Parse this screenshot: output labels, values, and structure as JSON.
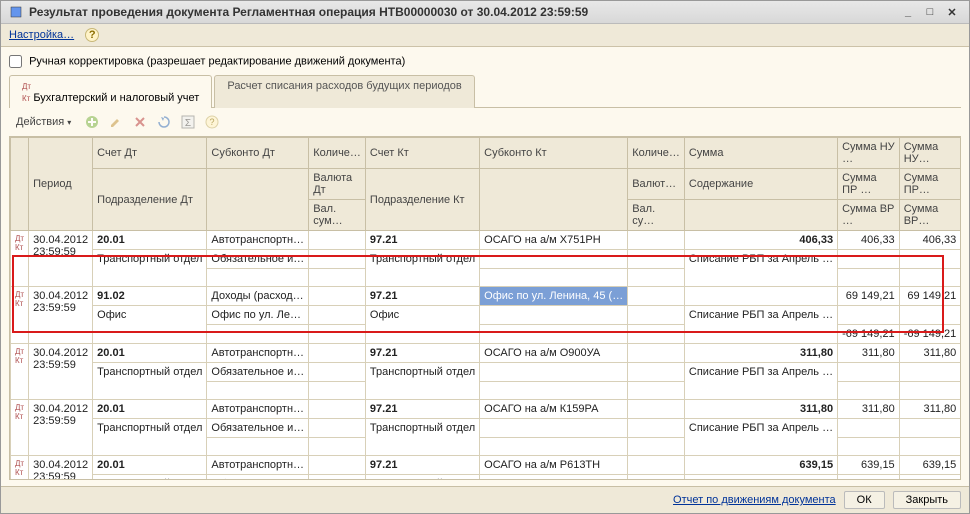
{
  "window": {
    "title": "Результат проведения документа Регламентная операция НТВ00000030 от 30.04.2012 23:59:59"
  },
  "menubar": {
    "settings": "Настройка…"
  },
  "checkbox": {
    "label": "Ручная корректировка (разрешает редактирование движений документа)"
  },
  "tabs": {
    "t1": "Бухгалтерский и налоговый учет",
    "t2": "Расчет списания расходов будущих периодов"
  },
  "toolbar": {
    "actions": "Действия"
  },
  "headers": {
    "r1": {
      "period": "Период",
      "schetDt": "Счет Дт",
      "subkDt": "Субконто Дт",
      "kolich": "Количе…",
      "schetKt": "Счет Кт",
      "subkKt": "Субконто Кт",
      "kolich2": "Количе…",
      "summa": "Сумма",
      "sumNU1": "Сумма НУ …",
      "sumNU2": "Сумма НУ…"
    },
    "r2": {
      "podrDt": "Подразделение Дт",
      "valDt": "Валюта Дт",
      "podrKt": "Подразделение Кт",
      "valKt": "Валют…",
      "soder": "Содержание",
      "sumPR1": "Сумма ПР …",
      "sumPR2": "Сумма ПР…"
    },
    "r3": {
      "valSum": "Вал. сум…",
      "valSu": "Вал. су…",
      "sumVR1": "Сумма ВР …",
      "sumVR2": "Сумма ВР…"
    }
  },
  "rows": [
    {
      "date": "30.04.2012",
      "time": "23:59:59",
      "schetDt": "20.01",
      "subkDt1": "Автотранспортн…",
      "subkDt2": "Обязательное и…",
      "schetKt": "97.21",
      "subkKt1": "ОСАГО на а/м Х751РН",
      "summa": "406,33",
      "sumNU1": "406,33",
      "sumNU2": "406,33",
      "podrDt": "Транспортный отдел",
      "podrKt": "Транспортный отдел",
      "soder": "Списание РБП за Апрель …"
    },
    {
      "date": "30.04.2012",
      "time": "23:59:59",
      "schetDt": "91.02",
      "subkDt1": "Доходы (расход…",
      "subkDt2": "Офис по ул. Ле…",
      "schetKt": "97.21",
      "subkKt1": "Офис по ул. Ленина, 45 (…",
      "summa": "",
      "sumNU1": "69 149,21",
      "sumNU2": "69 149,21",
      "podrDt": "Офис",
      "podrKt": "Офис",
      "soder": "Списание РБП за Апрель …",
      "sumVR1": "-69 149,21",
      "sumVR2": "-69 149,21"
    },
    {
      "date": "30.04.2012",
      "time": "23:59:59",
      "schetDt": "20.01",
      "subkDt1": "Автотранспортн…",
      "subkDt2": "Обязательное и…",
      "schetKt": "97.21",
      "subkKt1": "ОСАГО на а/м О900УА",
      "summa": "311,80",
      "sumNU1": "311,80",
      "sumNU2": "311,80",
      "podrDt": "Транспортный отдел",
      "podrKt": "Транспортный отдел",
      "soder": "Списание РБП за Апрель …"
    },
    {
      "date": "30.04.2012",
      "time": "23:59:59",
      "schetDt": "20.01",
      "subkDt1": "Автотранспортн…",
      "subkDt2": "Обязательное и…",
      "schetKt": "97.21",
      "subkKt1": "ОСАГО на а/м К159РА",
      "summa": "311,80",
      "sumNU1": "311,80",
      "sumNU2": "311,80",
      "podrDt": "Транспортный отдел",
      "podrKt": "Транспортный отдел",
      "soder": "Списание РБП за Апрель …"
    },
    {
      "date": "30.04.2012",
      "time": "23:59:59",
      "schetDt": "20.01",
      "subkDt1": "Автотранспортн…",
      "subkDt2": "Обязательное и…",
      "schetKt": "97.21",
      "subkKt1": "ОСАГО на а/м Р613ТН",
      "summa": "639,15",
      "sumNU1": "639,15",
      "sumNU2": "639,15",
      "podrDt": "Транспортный отдел",
      "podrKt": "Транспортный отдел",
      "soder": "Списание РБП за Апрель …"
    }
  ],
  "footer": {
    "link": "Отчет по движениям документа",
    "ok": "ОК",
    "close": "Закрыть"
  }
}
